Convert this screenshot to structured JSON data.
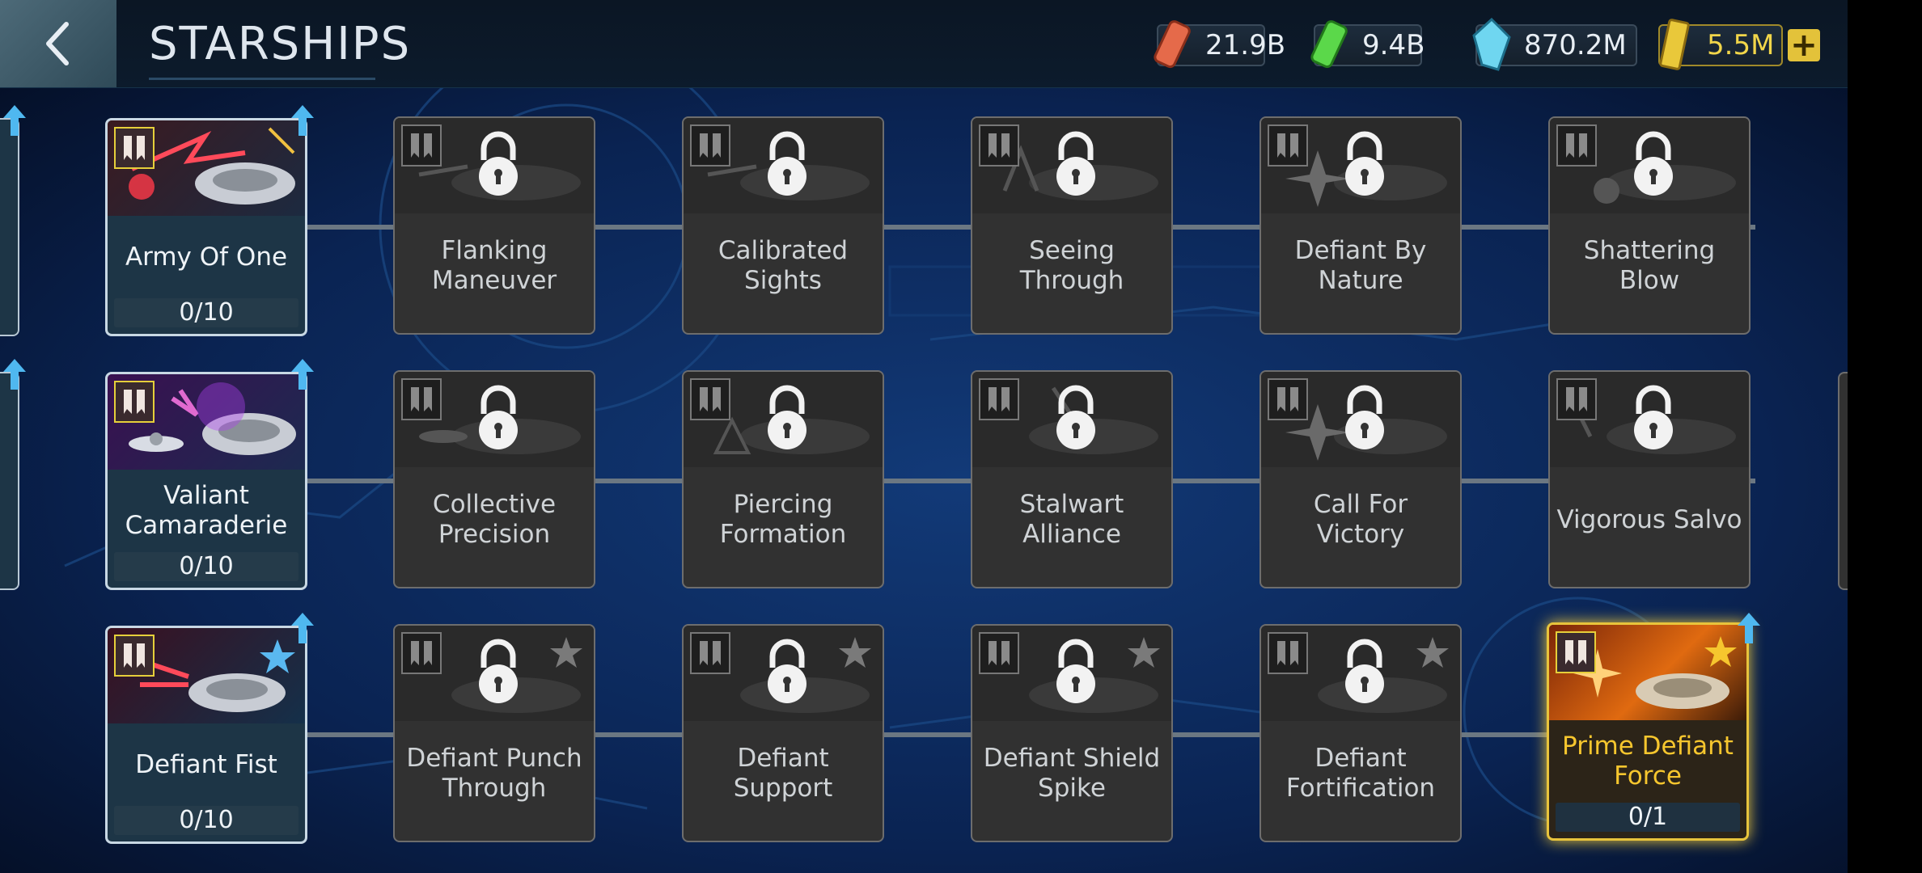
{
  "header": {
    "title": "STARSHIPS"
  },
  "resources": [
    {
      "name": "parsteel",
      "value": "21.9B",
      "color": "#e56a4a"
    },
    {
      "name": "tritanium",
      "value": "9.4B",
      "color": "#5bd84a"
    },
    {
      "name": "dilithium",
      "value": "870.2M",
      "color": "#6fd6f0"
    },
    {
      "name": "latinum",
      "value": "5.5M",
      "color": "#e9c83a"
    }
  ],
  "rows": [
    {
      "start": {
        "name": "Army Of One",
        "progress": "0/10",
        "theme": "red-gold"
      },
      "locked": [
        "Flanking Maneuver",
        "Calibrated Sights",
        "Seeing Through",
        "Defiant By Nature",
        "Shattering Blow"
      ]
    },
    {
      "start": {
        "name": "Valiant Camaraderie",
        "progress": "0/10",
        "theme": "purple"
      },
      "locked": [
        "Collective Precision",
        "Piercing Formation",
        "Stalwart Alliance",
        "Call For Victory",
        "Vigorous Salvo"
      ]
    },
    {
      "start": {
        "name": "Defiant Fist",
        "progress": "0/10",
        "theme": "red-blue"
      },
      "locked": [
        "Defiant Punch Through",
        "Defiant Support",
        "Defiant Shield Spike",
        "Defiant Fortification"
      ],
      "prime": {
        "name": "Prime Defiant Force",
        "progress": "0/1"
      }
    }
  ],
  "colors": {
    "accent": "#e8c43c",
    "upgrade_arrow": "#4fb8f0",
    "locked_card": "#313131"
  }
}
